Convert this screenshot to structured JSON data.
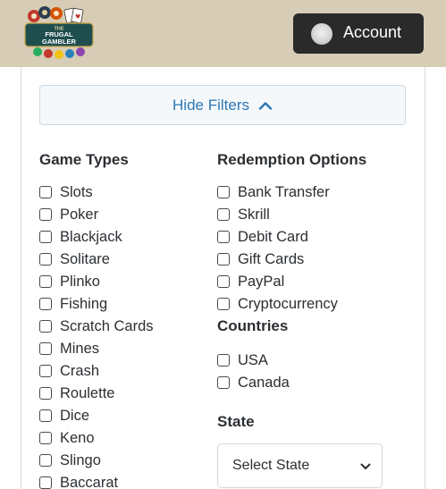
{
  "header": {
    "logo_text": {
      "line1": "THE",
      "line2": "FRUGAL",
      "line3": "GAMBLER"
    },
    "account_label": "Account"
  },
  "filters": {
    "toggle_label": "Hide Filters",
    "game_types": {
      "heading": "Game Types",
      "items": [
        "Slots",
        "Poker",
        "Blackjack",
        "Solitare",
        "Plinko",
        "Fishing",
        "Scratch Cards",
        "Mines",
        "Crash",
        "Roulette",
        "Dice",
        "Keno",
        "Slingo",
        "Baccarat"
      ]
    },
    "redemption_options": {
      "heading": "Redemption Options",
      "items": [
        "Bank Transfer",
        "Skrill",
        "Debit Card",
        "Gift Cards",
        "PayPal",
        "Cryptocurrency"
      ]
    },
    "countries": {
      "heading": "Countries",
      "items": [
        "USA",
        "Canada"
      ]
    },
    "state": {
      "heading": "State",
      "selected": "Select State"
    }
  },
  "colors": {
    "header_bg": "#d7ccb6",
    "account_bg": "#2a2a2a",
    "toggle_text": "#2d77b5",
    "toggle_bg": "#f4f8fb"
  },
  "icons": {
    "toggle": "chevron-up-icon",
    "select": "chevron-down-icon",
    "account": "user-avatar-icon"
  }
}
